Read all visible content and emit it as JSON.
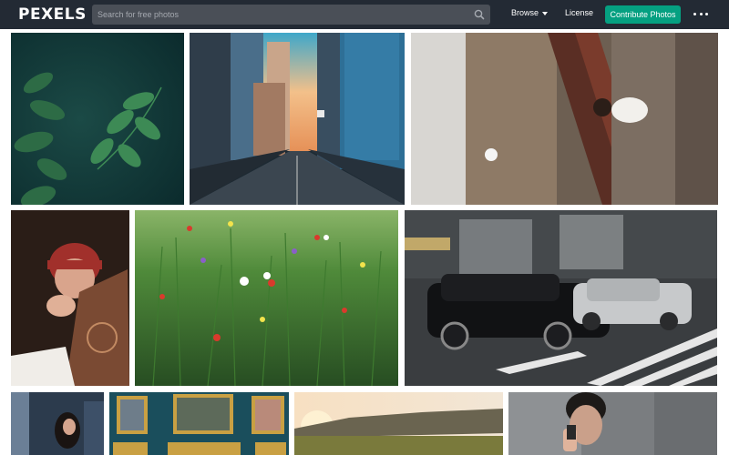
{
  "header": {
    "logo": "PEXELS",
    "search_placeholder": "Search for free photos",
    "nav_browse": "Browse",
    "nav_license": "License",
    "contribute_label": "Contribute Photos",
    "more_icon": "more-dots-icon",
    "search_icon": "search-icon"
  },
  "colors": {
    "header_bg": "#232a34",
    "search_bg": "#4a4f57",
    "accent_green": "#05a081"
  },
  "photos": [
    {
      "name": "photo-green-leaves"
    },
    {
      "name": "photo-city-street"
    },
    {
      "name": "photo-woman-staircase"
    },
    {
      "name": "photo-woman-holding-book"
    },
    {
      "name": "photo-wildflower-field"
    },
    {
      "name": "photo-cars-crosswalk"
    },
    {
      "name": "photo-woman-night-city"
    },
    {
      "name": "photo-gallery-wall"
    },
    {
      "name": "photo-sunset-landscape"
    },
    {
      "name": "photo-man-on-phone"
    }
  ]
}
